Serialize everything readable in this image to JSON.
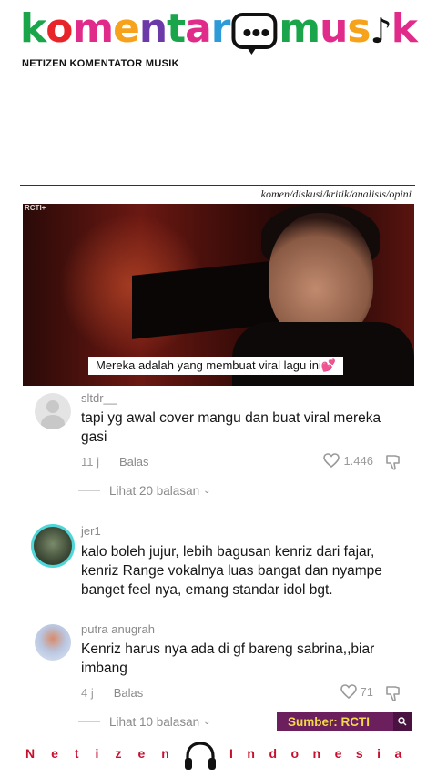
{
  "header": {
    "logo_letters": [
      "k",
      "o",
      "m",
      "e",
      "n",
      "t",
      "a",
      "r"
    ],
    "logo_colors": [
      "#1aa54a",
      "#e8242b",
      "#e12b8a",
      "#f6a21b",
      "#6c3aa8",
      "#1aa54a",
      "#e12b8a",
      "#2d9bd8"
    ],
    "logo_suffix_letters": [
      "m",
      "u",
      "s",
      "i",
      "k"
    ],
    "logo_suffix_colors": [
      "#1aa54a",
      "#e12b8a",
      "#f6a21b",
      "#1aa54a",
      "#e12b8a"
    ],
    "tagline": "NETIZEN KOMENTATOR MUSIK",
    "subtag": "komen/diskusi/kritik/analisis/opini"
  },
  "video": {
    "brand": "RCTI+",
    "caption": "Mereka adalah yang membuat viral lagu ini",
    "caption_emoji": "💕"
  },
  "comments": [
    {
      "username": "sltdr__",
      "text": "tapi yg awal cover mangu dan buat viral mereka gasi",
      "time": "11 j",
      "reply_label": "Balas",
      "likes": "1.446",
      "view_replies": "Lihat 20 balasan"
    },
    {
      "username": "jer1",
      "text": "kalo boleh jujur, lebih bagusan kenriz dari fajar, kenriz Range vokalnya luas bangat dan nyampe banget feel nya, emang standar idol bgt."
    },
    {
      "username": "putra anugrah",
      "text": "Kenriz harus nya ada di gf bareng sabrina,,biar imbang",
      "time": "4 j",
      "reply_label": "Balas",
      "likes": "71",
      "view_replies": "Lihat 10 balasan"
    }
  ],
  "source_badge": "Sumber: RCTI",
  "footer": {
    "left": "Netizen",
    "right": "Indonesia"
  }
}
